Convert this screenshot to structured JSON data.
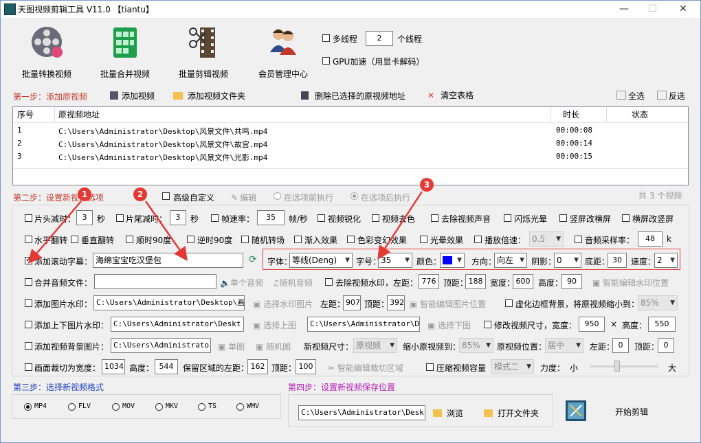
{
  "window": {
    "title": "天图视频剪辑工具 V11.0 【tiantu】",
    "min": "—",
    "max": "☐",
    "close": "✕"
  },
  "toolbar": [
    {
      "label": "批量转换视频",
      "icon": "film-reel-icon"
    },
    {
      "label": "批量合并视频",
      "icon": "merge-grid-icon"
    },
    {
      "label": "批量剪辑视频",
      "icon": "film-scissors-icon"
    },
    {
      "label": "会员管理中心",
      "icon": "users-icon"
    }
  ],
  "options": {
    "multithread_label": "多线程",
    "thread_count": "2",
    "thread_unit": "个线程",
    "gpu_label": "GPU加速（用显卡解码）"
  },
  "step1": {
    "title": "第一步：添加原视频",
    "add_video": "添加视频",
    "add_folder": "添加视频文件夹",
    "delete_selected": "删除已选择的原视频地址",
    "clear_table": "清空表格",
    "select_all": "全选",
    "invert": "反选"
  },
  "table": {
    "headers": [
      "序号",
      "原视频地址",
      "时长",
      "状态"
    ],
    "rows": [
      {
        "no": "1",
        "path": "C:\\Users\\Administrator\\Desktop\\风景文件\\共鸣.mp4",
        "duration": "00:00:08",
        "status": ""
      },
      {
        "no": "2",
        "path": "C:\\Users\\Administrator\\Desktop\\风景文件\\故宫.mp4",
        "duration": "00:00:14",
        "status": ""
      },
      {
        "no": "3",
        "path": "C:\\Users\\Administrator\\Desktop\\风景文件\\光影.mp4",
        "duration": "00:00:15",
        "status": ""
      }
    ],
    "count_text": "共 3 个视频"
  },
  "step2": {
    "title": "第二步：设置新视频选项",
    "advanced": "高级自定义",
    "edit": "编辑",
    "before": "在选项前执行",
    "after": "在选项后执行",
    "row1": {
      "head_cut": "片头减时：",
      "head_val": "3",
      "sec1": "秒",
      "tail_cut": "片尾减时：",
      "tail_val": "3",
      "sec2": "秒",
      "fps": "帧速率：",
      "fps_val": "35",
      "fps_unit": "帧/秒",
      "sharpen": "视频锐化",
      "decolor": "视频去色",
      "remove_audio": "去除视频声音",
      "flash": "闪烁光晕",
      "v2h": "竖屏改横屏",
      "h2v": "横屏改竖屏"
    },
    "row2": {
      "hflip": "水平翻转",
      "vflip": "垂直翻转",
      "cw90": "顺时90度",
      "ccw90": "逆时90度",
      "random_trans": "随机转场",
      "fade_in": "渐入效果",
      "color_grade": "色彩变幻效果",
      "halo": "光晕效果",
      "speed": "播放倍速：",
      "speed_val": "0.5",
      "samplerate": "音频采样率：",
      "samplerate_val": "48",
      "k": "k"
    },
    "row3": {
      "scroll_sub": "添加滚动字幕：",
      "scroll_text": "海绵宝宝吃汉堡包",
      "font": "字体：",
      "font_val": "等线(Deng)",
      "size": "字号：",
      "size_val": "35",
      "color": "颜色：",
      "color_hex": "#0000ff",
      "dir": "方向：",
      "dir_val": "向左",
      "shadow": "阴影：",
      "shadow_val": "0",
      "bottom": "底距：",
      "bottom_val": "30",
      "velocity": "速度：",
      "velocity_val": "2"
    },
    "row4": {
      "merge_audio": "合并音频文件：",
      "single_audio": "单个音频",
      "random_audio": "随机音频",
      "remove_wm": "去除视频水印，左距：",
      "left_val": "776",
      "top": "顶距：",
      "top_val": "188",
      "width": "宽度：",
      "width_val": "600",
      "height": "高度：",
      "height_val": "90",
      "smart_wm": "智能编辑水印位置"
    },
    "row5": {
      "img_wm": "添加图片水印：",
      "img_path": "C:\\Users\\Administrator\\Desktop\\画中画",
      "choose_img": "选择水印图片",
      "left": "左距：",
      "left_val": "907",
      "top": "顶距：",
      "top_val": "392",
      "smart_img": "智能编辑图片位置",
      "blur_bg": "虚化边框背景，将原视频缩小到：",
      "blur_val": "85%"
    },
    "row6": {
      "updown_wm": "添加上下图片水印：",
      "path1": "C:\\Users\\Administrator\\Deskt",
      "choose_up": "选择上图",
      "path2": "C:\\Users\\Administrator\\Deskt",
      "choose_down": "选择下图",
      "resize": "修改视频尺寸，宽度：",
      "w_val": "950",
      "x": "×",
      "height": "高度：",
      "h_val": "550"
    },
    "row7": {
      "bg_img": "添加视频背景图片：",
      "path": "C:\\Users\\Administrator\\D",
      "single": "单图",
      "random": "随机图",
      "new_size": "新视频尺寸：",
      "new_size_val": "原视频",
      "shrink": "缩小原视频到：",
      "shrink_val": "85%",
      "pos": "原视频位置：",
      "pos_val": "居中",
      "left": "左距：",
      "left_val": "0",
      "top": "顶距：",
      "top_val": "0"
    },
    "row8": {
      "crop": "画面裁切为宽度：",
      "crop_w": "1034",
      "height": "高度：",
      "crop_h": "544",
      "keep_left": "保留区域的左距：",
      "left_val": "162",
      "top": "顶距：",
      "top_val": "100",
      "smart_crop": "智能编辑裁切区域",
      "compress": "压缩视频容量",
      "mode_val": "模式二",
      "strength": "力度：",
      "small": "小",
      "big": "大",
      "strength_level": 0.4
    }
  },
  "step3": {
    "title": "第三步：选择新视频格式",
    "formats": [
      "MP4",
      "FLV",
      "MOV",
      "MKV",
      "TS",
      "WMV"
    ],
    "selected": "MP4"
  },
  "step4": {
    "title": "第四步：设置新视频保存位置",
    "path": "C:\\Users\\Administrator\\Desktop\\",
    "browse": "浏览",
    "open_folder": "打开文件夹",
    "start": "开始剪辑"
  },
  "annotations": [
    "1",
    "2",
    "3"
  ],
  "colors": {
    "step_red": "#c0392b",
    "step_blue": "#1f3ebf",
    "step_purple": "#b51fb5",
    "marker_red": "#e53935"
  }
}
